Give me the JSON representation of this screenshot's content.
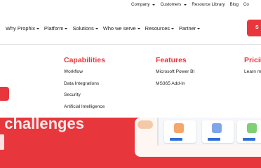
{
  "utility_nav": [
    {
      "label": "Company",
      "has_dropdown": true
    },
    {
      "label": "Customers",
      "has_dropdown": true
    },
    {
      "label": "Resource Library",
      "has_dropdown": false
    },
    {
      "label": "Blog",
      "has_dropdown": false
    },
    {
      "label": "Co",
      "has_dropdown": false
    }
  ],
  "main_nav": [
    {
      "label": "Why Prophix"
    },
    {
      "label": "Platform"
    },
    {
      "label": "Solutions"
    },
    {
      "label": "Who we serve"
    },
    {
      "label": "Resources"
    },
    {
      "label": "Partner"
    }
  ],
  "cta_label": "S",
  "mega_menu": {
    "capabilities": {
      "title": "Capabilities",
      "items": [
        "Workflow",
        "Data Integrations",
        "Security",
        "Artificial Intelligence"
      ]
    },
    "features": {
      "title": "Features",
      "items": [
        "Microsoft Power BI",
        "MS365 Add-In"
      ]
    },
    "pricing": {
      "title": "Pricii",
      "items": [
        "Learn m"
      ]
    }
  },
  "hero": {
    "headline_fragment": "ı challenges"
  },
  "colors": {
    "brand_red": "#e8373c",
    "text_dark": "#1a1a1a",
    "card_button_blue": "#2f6fd6"
  }
}
